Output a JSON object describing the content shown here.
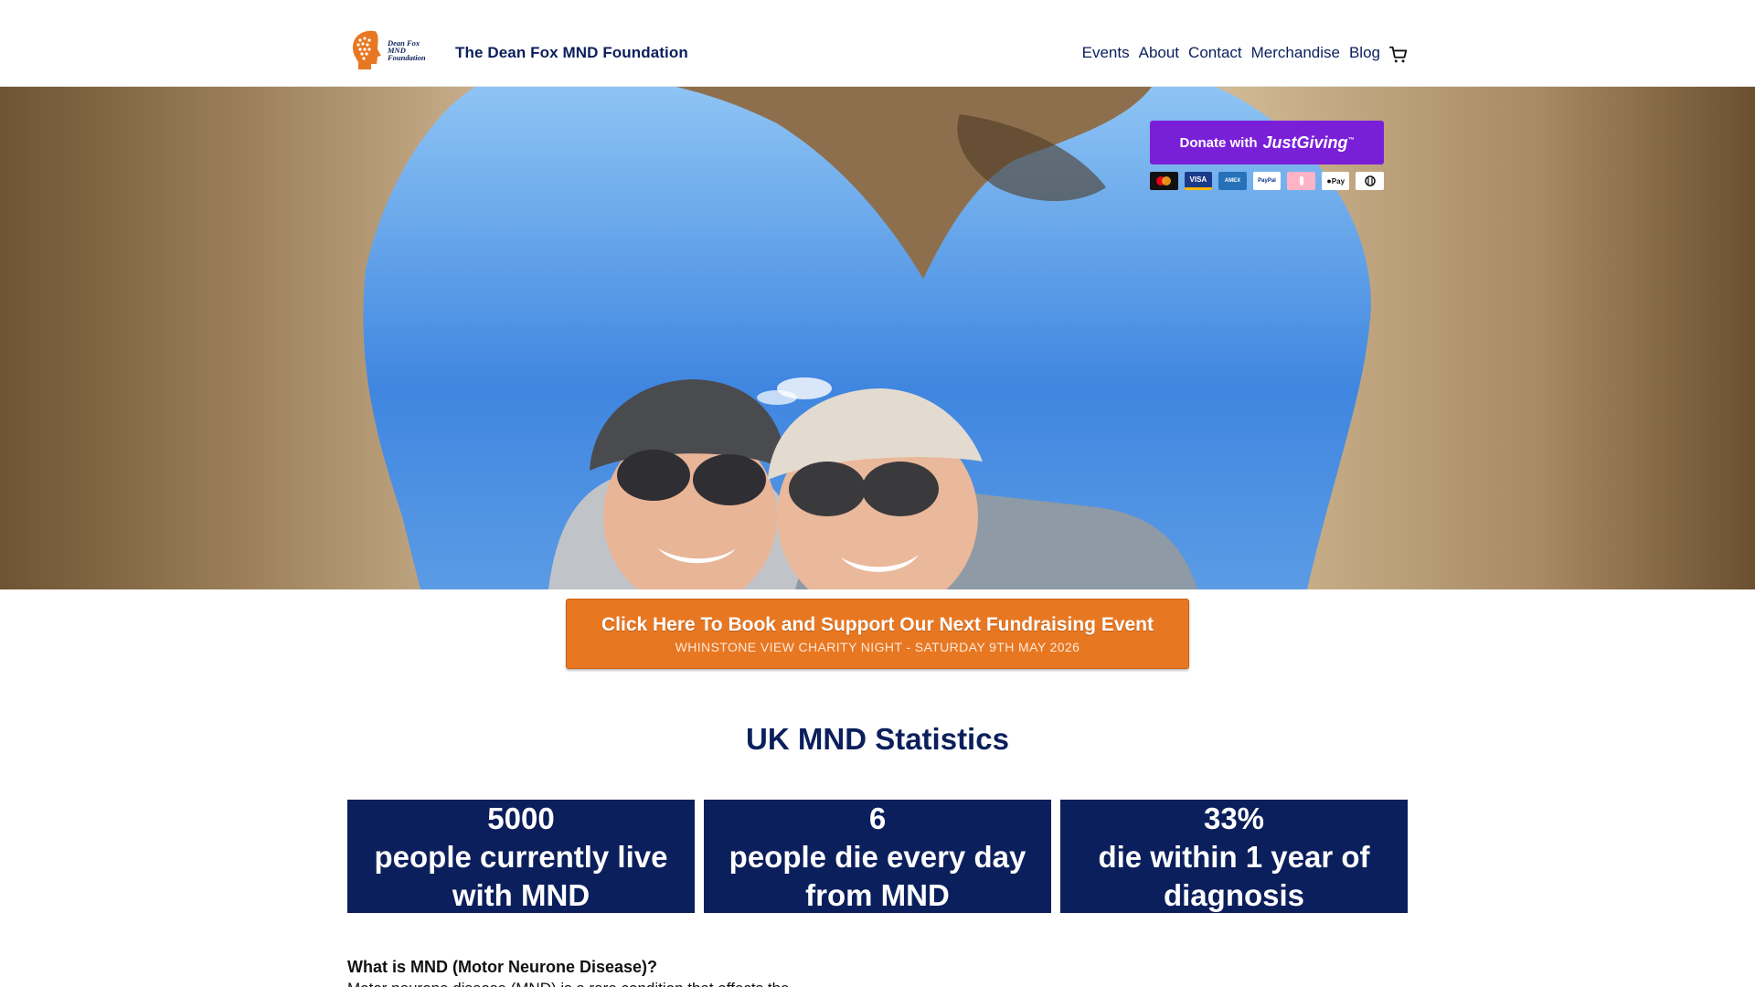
{
  "header": {
    "logo_text": [
      "Dean Fox",
      "MND",
      "Foundation"
    ],
    "site_title": "The Dean Fox MND Foundation",
    "nav": [
      "Events",
      "About",
      "Contact",
      "Merchandise",
      "Blog"
    ],
    "cart_icon": "cart-icon"
  },
  "hero": {
    "donate_label": "Donate with",
    "donate_brand": "JustGiving",
    "payment_methods": [
      "mastercard-icon",
      "visa-icon",
      "amex-icon",
      "paypal-icon",
      "klarna-icon",
      "applepay-icon",
      "dinersclub-icon"
    ],
    "payment_labels": [
      "",
      "VISA",
      "AMEX",
      "PayPal",
      "",
      "Pay",
      ""
    ]
  },
  "cta": {
    "title": "Click Here To Book and Support Our Next Fundraising Event",
    "subtitle": "WHINSTONE VIEW CHARITY NIGHT - SATURDAY 9TH MAY 2026"
  },
  "stats": {
    "heading": "UK MND Statistics",
    "items": [
      {
        "value": "5000",
        "label": "people currently live with MND"
      },
      {
        "value": "6",
        "label": "people die every day from MND"
      },
      {
        "value": "33%",
        "label": "die within 1 year of diagnosis"
      }
    ]
  },
  "content": {
    "question": "What is MND (Motor Neurone Disease)?",
    "body": "Motor neurone disease (MND) is a rare  condition that affects the"
  },
  "colors": {
    "navy": "#0b1f5c",
    "orange": "#e87722",
    "justgiving_purple": "#7a1fd8"
  }
}
